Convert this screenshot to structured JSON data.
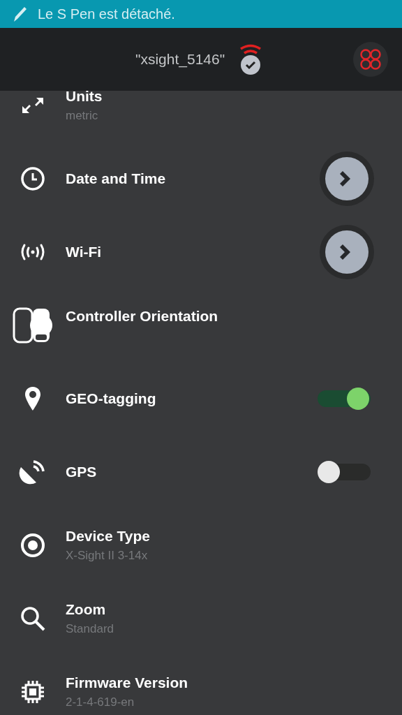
{
  "status_bar": {
    "text": "Le S Pen est détaché."
  },
  "header": {
    "title": "\"xsight_5146\""
  },
  "settings": [
    {
      "kind": "plain",
      "title": "Units",
      "subtitle": "metric"
    },
    {
      "kind": "arrow",
      "title": "Date and Time"
    },
    {
      "kind": "arrow",
      "title": "Wi-Fi"
    },
    {
      "kind": "plain",
      "title": "Controller Orientation"
    },
    {
      "kind": "toggle",
      "title": "GEO-tagging",
      "on": true
    },
    {
      "kind": "toggle",
      "title": "GPS",
      "on": false
    },
    {
      "kind": "plain",
      "title": "Device Type",
      "subtitle": "X-Sight II 3-14x"
    },
    {
      "kind": "plain",
      "title": "Zoom",
      "subtitle": "Standard"
    },
    {
      "kind": "plain",
      "title": "Firmware Version",
      "subtitle": "2-1-4-619-en"
    }
  ]
}
